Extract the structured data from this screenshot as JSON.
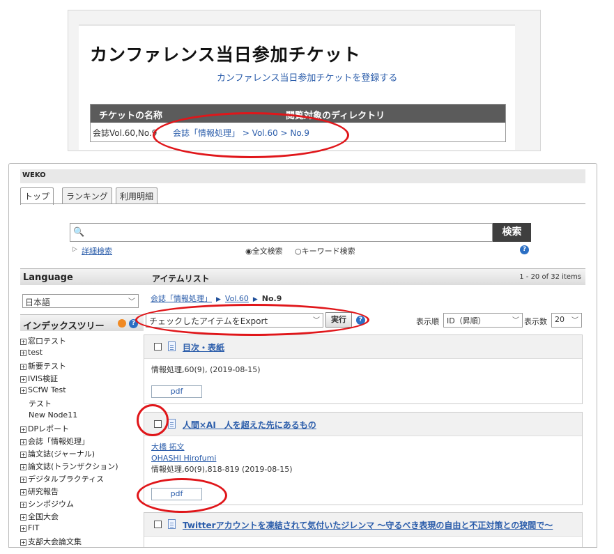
{
  "ticket": {
    "title": "カンファレンス当日参加チケット",
    "register_link": "カンファレンス当日参加チケットを登録する",
    "col_name": "チケットの名称",
    "col_dir": "閲覧対象のディレクトリ",
    "row_name": "会誌Vol.60,No.9",
    "row_dir": "会誌「情報処理」 > Vol.60 > No.9"
  },
  "weko": {
    "brand": "WEKO",
    "tabs": [
      "トップ",
      "ランキング",
      "利用明細"
    ],
    "search_icon_glyph": "🔍",
    "search_button": "検索",
    "advanced_search": "詳細検索",
    "radio_fulltext": "◉全文検索",
    "radio_keyword": "○キーワード検索",
    "help_glyph": "?"
  },
  "sidebar": {
    "language_header": "Language",
    "language_value": "日本語",
    "index_tree_header": "インデックスツリー",
    "tree": [
      {
        "label": "窓口テスト",
        "child": false
      },
      {
        "label": "test",
        "child": false
      },
      {
        "label": "新要テスト",
        "child": false
      },
      {
        "label": "IVIS検証",
        "child": false
      },
      {
        "label": "SCfW Test",
        "child": false
      },
      {
        "label": "テスト",
        "child": true
      },
      {
        "label": "New Node11",
        "child": true
      },
      {
        "label": "DPレポート",
        "child": false
      },
      {
        "label": "会誌「情報処理」",
        "child": false
      },
      {
        "label": "論文誌(ジャーナル)",
        "child": false
      },
      {
        "label": "論文誌(トランザクション)",
        "child": false
      },
      {
        "label": "デジタルプラクティス",
        "child": false
      },
      {
        "label": "研究報告",
        "child": false
      },
      {
        "label": "シンポジウム",
        "child": false
      },
      {
        "label": "全国大会",
        "child": false
      },
      {
        "label": "FIT",
        "child": false
      },
      {
        "label": "支部大会論文集",
        "child": false
      }
    ]
  },
  "itemlist": {
    "header": "アイテムリスト",
    "count": "1 - 20 of 32 items",
    "crumb_1": "会誌「情報処理」",
    "crumb_2": "Vol.60",
    "crumb_3": "No.9",
    "export_option": "チェックしたアイテムをExport",
    "run_button": "実行",
    "sort_label": "表示順",
    "sort_value": "ID（昇順）",
    "count_label": "表示数",
    "count_value": "20",
    "items": [
      {
        "title": "目次・表紙",
        "author_ja": "",
        "author_en": "",
        "meta": "情報処理,60(9), (2019-08-15)",
        "file": "pdf"
      },
      {
        "title": "人間×AI　人を超えた先にあるもの",
        "author_ja": "大橋 拓文",
        "author_en": "OHASHI Hirofumi",
        "meta": "情報処理,60(9),818-819 (2019-08-15)",
        "file": "pdf"
      },
      {
        "title": "Twitterアカウントを凍結されて気付いたジレンマ ～守るべき表現の自由と不正対策との狭間で～"
      }
    ]
  },
  "colors": {
    "annotation": "#e0161a",
    "link": "#2a5caa",
    "button_dark": "#3f3f3f"
  }
}
